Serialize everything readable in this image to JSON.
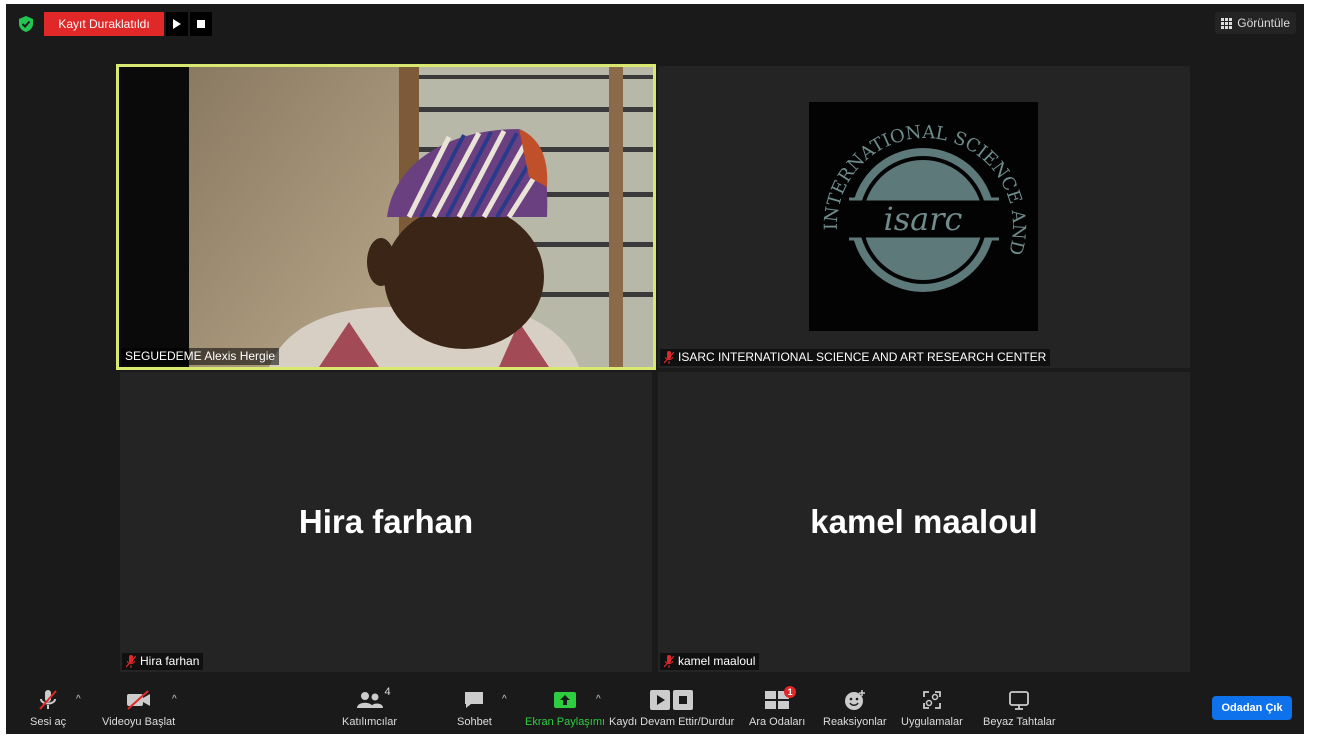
{
  "topbar": {
    "recording_status": "Kayıt Duraklatıldı",
    "view_label": "Görüntüle"
  },
  "tiles": [
    {
      "name": "SEGUEDEME Alexis Hergie",
      "muted": false,
      "active_speaker": true
    },
    {
      "name": "ISARC INTERNATIONAL SCIENCE AND ART RESEARCH CENTER",
      "muted": true
    },
    {
      "name": "Hira farhan",
      "display_name": "Hira farhan",
      "muted": true
    },
    {
      "name": "kamel maaloul",
      "display_name": "kamel maaloul",
      "muted": true
    }
  ],
  "logo": {
    "top_text": "INTERNATIONAL SCIENCE AND ART RESEARCH CENTER",
    "center_text": "isarc"
  },
  "toolbar": {
    "audio": "Sesi aç",
    "video": "Videoyu Başlat",
    "participants": "Katılımcılar",
    "participants_count": "4",
    "chat": "Sohbet",
    "share": "Ekran Paylaşımı",
    "recording": "Kaydı Devam Ettir/Durdur",
    "breakout": "Ara Odaları",
    "breakout_badge": "1",
    "reactions": "Reaksiyonlar",
    "apps": "Uygulamalar",
    "whiteboards": "Beyaz Tahtalar",
    "leave": "Odadan Çık"
  },
  "colors": {
    "background": "#1a1a1a",
    "tile": "#242424",
    "speaker_border": "#d9e870",
    "record": "#e02828",
    "leave": "#0e72ed",
    "share": "#2ecc40"
  }
}
